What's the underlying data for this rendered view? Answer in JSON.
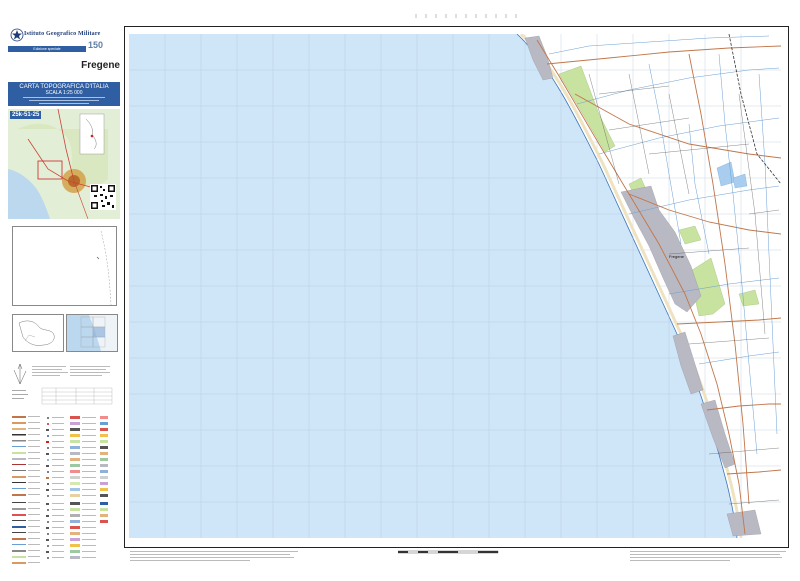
{
  "header": {
    "institute": "Istituto Geografico Militare",
    "edition_label": "Edizione speciale",
    "anniversary": "150"
  },
  "sheet": {
    "name": "Fregene",
    "series_title": "CARTA TOPOGRAFICA D'ITALIA",
    "scale_label": "SCALA 1:25 000",
    "code": "25k-51-25"
  },
  "colors": {
    "sea": "#cfe5f8",
    "land": "#ffffff",
    "green": "#c8e2a0",
    "urban": "#b9b9c4",
    "road": "#c0764a",
    "canal": "#6a9fd4",
    "igm_blue": "#2f5ea3"
  },
  "map": {
    "place_labels": [
      "Fregene"
    ]
  }
}
